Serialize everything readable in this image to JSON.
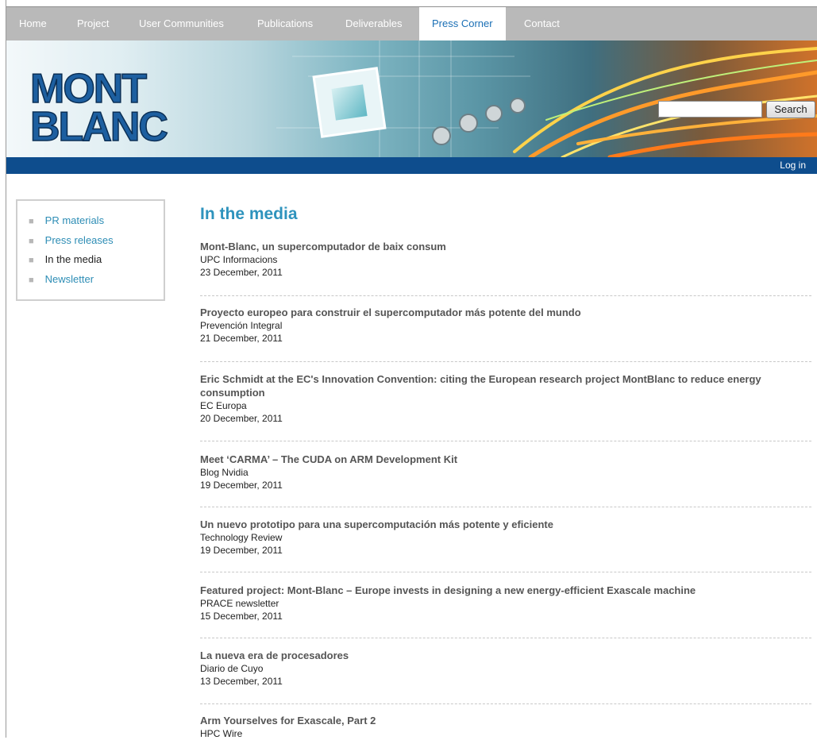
{
  "nav": {
    "items": [
      "Home",
      "Project",
      "User Communities",
      "Publications",
      "Deliverables",
      "Press Corner",
      "Contact"
    ],
    "active": "Press Corner"
  },
  "header": {
    "logo_text": "MONT BLANC",
    "search": {
      "placeholder": "",
      "button_label": "Search"
    },
    "login_label": "Log in"
  },
  "sidebar": {
    "items": [
      {
        "label": "PR materials",
        "current": false
      },
      {
        "label": "Press releases",
        "current": false
      },
      {
        "label": "In the media",
        "current": true
      },
      {
        "label": "Newsletter",
        "current": false
      }
    ]
  },
  "main": {
    "heading": "In the media",
    "articles": [
      {
        "title": "Mont-Blanc, un supercomputador de baix consum",
        "source": "UPC Informacions",
        "date": "23 December, 2011"
      },
      {
        "title": "Proyecto europeo para construir el supercomputador más potente del mundo",
        "source": "Prevención Integral",
        "date": "21 December, 2011"
      },
      {
        "title": "Eric Schmidt at the EC's Innovation Convention: citing the European research project MontBlanc to reduce energy consumption",
        "source": "EC Europa",
        "date": "20 December, 2011"
      },
      {
        "title": "Meet ‘CARMA’ – The CUDA on ARM Development Kit",
        "source": "Blog Nvidia",
        "date": "19 December, 2011"
      },
      {
        "title": "Un nuevo prototipo para una supercomputación más potente y eficiente",
        "source": "Technology Review",
        "date": "19 December, 2011"
      },
      {
        "title": "Featured project: Mont-Blanc – Europe invests in designing a new energy-efficient Exascale machine",
        "source": "PRACE newsletter",
        "date": "15 December, 2011"
      },
      {
        "title": "La nueva era de procesadores",
        "source": "Diario de Cuyo",
        "date": "13 December, 2011"
      },
      {
        "title": "Arm Yourselves for Exascale, Part 2",
        "source": "HPC Wire",
        "date": ""
      }
    ]
  },
  "colors": {
    "nav_bg": "#b9b9b9",
    "accent_blue": "#0e4d8d",
    "link": "#2d8db5",
    "heading": "#2e93bd"
  }
}
